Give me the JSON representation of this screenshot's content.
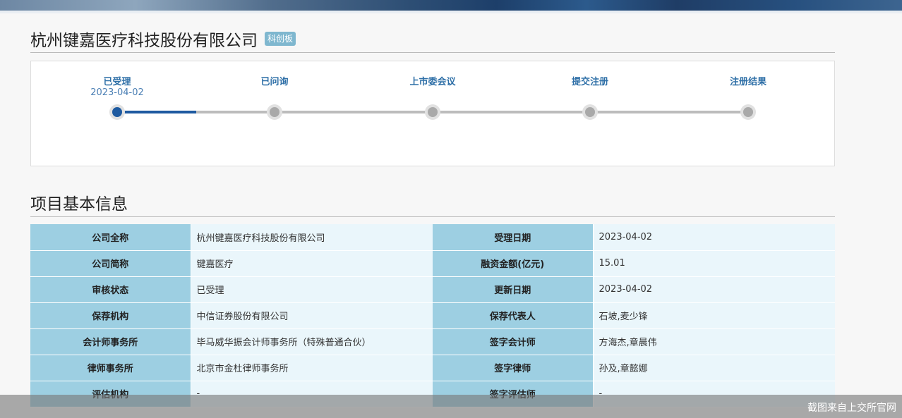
{
  "company": {
    "name": "杭州键嘉医疗科技股份有限公司",
    "board_tag": "科创板"
  },
  "progress": {
    "steps": [
      {
        "label": "已受理",
        "date": "2023-04-02",
        "done": true
      },
      {
        "label": "已问询",
        "date": "",
        "done": false
      },
      {
        "label": "上市委会议",
        "date": "",
        "done": false
      },
      {
        "label": "提交注册",
        "date": "",
        "done": false
      },
      {
        "label": "注册结果",
        "date": "",
        "done": false
      }
    ],
    "colors": {
      "done": "#1e5aa0",
      "pending": "#a9a9a9"
    }
  },
  "section": {
    "title": "项目基本信息"
  },
  "info_table": {
    "rows": [
      {
        "k1": "公司全称",
        "v1": "杭州键嘉医疗科技股份有限公司",
        "k2": "受理日期",
        "v2": "2023-04-02"
      },
      {
        "k1": "公司简称",
        "v1": "键嘉医疗",
        "k2": "融资金额(亿元)",
        "v2": "15.01"
      },
      {
        "k1": "审核状态",
        "v1": "已受理",
        "k2": "更新日期",
        "v2": "2023-04-02"
      },
      {
        "k1": "保荐机构",
        "v1": "中信证券股份有限公司",
        "k2": "保荐代表人",
        "v2": "石坡,麦少锋"
      },
      {
        "k1": "会计师事务所",
        "v1": "毕马威华振会计师事务所（特殊普通合伙）",
        "k2": "签字会计师",
        "v2": "方海杰,章晨伟"
      },
      {
        "k1": "律师事务所",
        "v1": "北京市金杜律师事务所",
        "k2": "签字律师",
        "v2": "孙及,章懿娜"
      },
      {
        "k1": "评估机构",
        "v1": "-",
        "k2": "签字评估师",
        "v2": "-"
      }
    ]
  },
  "watermark": "截图来自上交所官网"
}
